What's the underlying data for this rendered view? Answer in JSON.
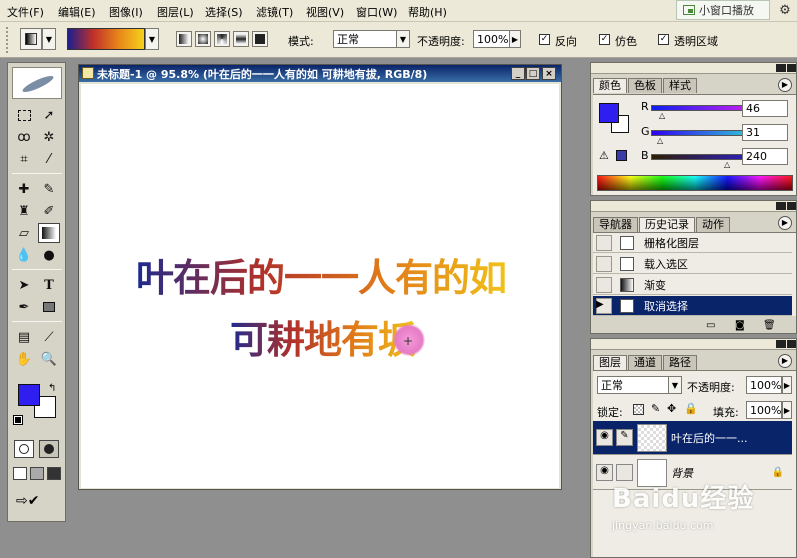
{
  "menu": {
    "items": [
      "文件(F)",
      "编辑(E)",
      "图像(I)",
      "图层(L)",
      "选择(S)",
      "滤镜(T)",
      "视图(V)",
      "窗口(W)",
      "帮助(H)"
    ],
    "pip_label": "小窗口播放"
  },
  "options": {
    "mode_label": "模式:",
    "mode_value": "正常",
    "opacity_label": "不透明度:",
    "opacity_value": "100%",
    "reverse_label": "反向",
    "dither_label": "仿色",
    "transparency_label": "透明区域",
    "reverse_checked": true,
    "dither_checked": true,
    "transparency_checked": true
  },
  "document": {
    "title": "未标题-1 @ 95.8% (叶在后的一一人有的如 可耕地有拔, RGB/8)",
    "line1": "叶在后的一一人有的如",
    "line2": "可耕地有坂",
    "gradient_colors": [
      "#1d2a8e",
      "#b0302a",
      "#e07a1a",
      "#f1c21a"
    ]
  },
  "color_panel": {
    "tabs": [
      "颜色",
      "色板",
      "样式"
    ],
    "r_label": "R",
    "g_label": "G",
    "b_label": "B",
    "r_value": "46",
    "g_value": "31",
    "b_value": "240",
    "foreground": "#2e1ff0",
    "background": "#ffffff"
  },
  "history_panel": {
    "tabs": [
      "导航器",
      "历史记录",
      "动作"
    ],
    "items": [
      "栅格化图层",
      "载入选区",
      "渐变",
      "取消选择"
    ],
    "selected_index": 3
  },
  "layers_panel": {
    "tabs": [
      "图层",
      "通道",
      "路径"
    ],
    "blend_mode": "正常",
    "opacity_label": "不透明度:",
    "opacity_value": "100%",
    "lock_label": "锁定:",
    "fill_label": "填充:",
    "fill_value": "100%",
    "layers": [
      {
        "name": "叶在后的一一...",
        "selected": true
      },
      {
        "name": "背景",
        "selected": false
      }
    ]
  },
  "watermark": {
    "brand": "Baidu经验",
    "url": "jingyan.baidu.com"
  }
}
